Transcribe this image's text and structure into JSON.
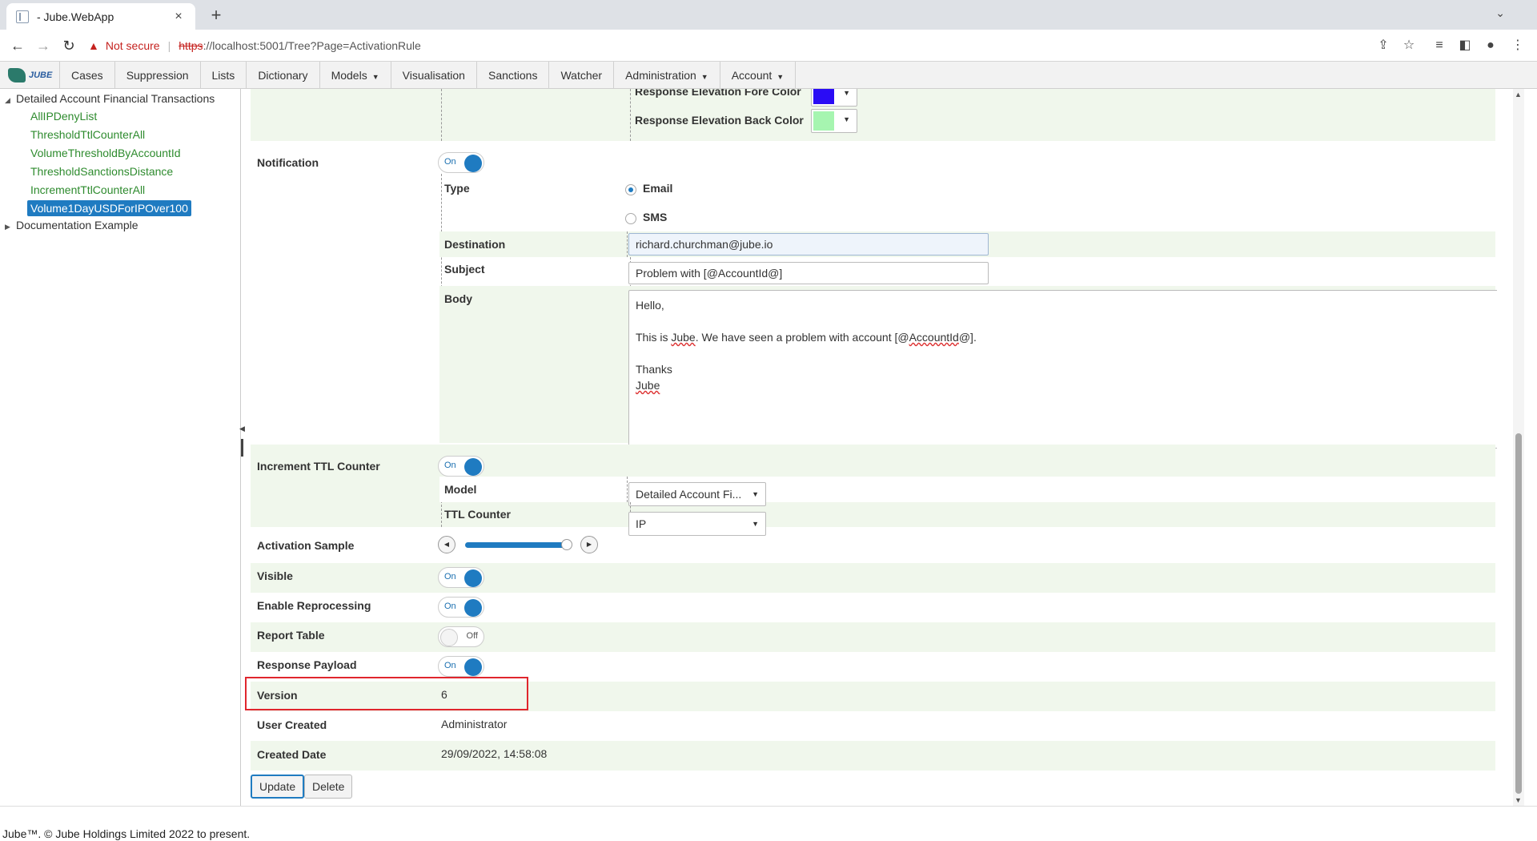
{
  "browser": {
    "tab_title": "- Jube.WebApp",
    "tab_close": "×",
    "new_tab": "+",
    "security_label": "Not secure",
    "url_scheme": "https",
    "url_rest": "://localhost:5001/Tree?Page=ActivationRule"
  },
  "menu": {
    "logo_text": "JUBE",
    "items": [
      {
        "label": "Cases"
      },
      {
        "label": "Suppression"
      },
      {
        "label": "Lists"
      },
      {
        "label": "Dictionary"
      },
      {
        "label": "Models",
        "has_caret": true
      },
      {
        "label": "Visualisation"
      },
      {
        "label": "Sanctions"
      },
      {
        "label": "Watcher"
      },
      {
        "label": "Administration",
        "has_caret": true
      },
      {
        "label": "Account",
        "has_caret": true
      }
    ]
  },
  "tree": {
    "root1": "Detailed Account Financial Transactions",
    "leaves": [
      "AllIPDenyList",
      "ThresholdTtlCounterAll",
      "VolumeThresholdByAccountId",
      "ThresholdSanctionsDistance",
      "IncrementTtlCounterAll",
      "Volume1DayUSDForIPOver100"
    ],
    "selected_index": 5,
    "root2": "Documentation Example"
  },
  "form": {
    "response_elevation_fore_color_label": "Response Elevation Fore Color",
    "response_elevation_fore_color": "#2a0cf5",
    "response_elevation_back_color_label": "Response Elevation Back Color",
    "response_elevation_back_color": "#a6f5b0",
    "notification": {
      "label": "Notification",
      "toggle": "On",
      "type_label": "Type",
      "type_options": [
        "Email",
        "SMS"
      ],
      "type_selected": "Email",
      "destination_label": "Destination",
      "destination_value": "richard.churchman@jube.io",
      "subject_label": "Subject",
      "subject_value": "Problem with [@AccountId@]",
      "body_label": "Body",
      "body_line1": "Hello,",
      "body_line3_pre": "This is ",
      "body_line3_spell1": "Jube",
      "body_line3_mid": ".  We have seen a problem with account [@",
      "body_line3_spell2": "AccountId",
      "body_line3_post": "@].",
      "body_line5": "Thanks",
      "body_line6": "Jube"
    },
    "increment_ttl_counter": {
      "label": "Increment TTL Counter",
      "toggle": "On",
      "model_label": "Model",
      "model_value": "Detailed Account Fi...",
      "ttl_counter_label": "TTL Counter",
      "ttl_counter_value": "IP"
    },
    "activation_sample": {
      "label": "Activation Sample",
      "left_arrow": "◀",
      "right_arrow": "▶",
      "level_fraction": 0.98
    },
    "visible": {
      "label": "Visible",
      "toggle": "On"
    },
    "enable_reprocessing": {
      "label": "Enable Reprocessing",
      "toggle": "On"
    },
    "report_table": {
      "label": "Report Table",
      "toggle": "Off"
    },
    "response_payload": {
      "label": "Response Payload",
      "toggle": "On"
    },
    "version": {
      "label": "Version",
      "value": "6"
    },
    "user_created": {
      "label": "User Created",
      "value": "Administrator"
    },
    "created_date": {
      "label": "Created Date",
      "value": "29/09/2022, 14:58:08"
    },
    "update_label": "Update",
    "delete_label": "Delete"
  },
  "footer": {
    "text": "Jube™. © Jube Holdings Limited 2022 to present."
  },
  "colors": {
    "accent": "#1f7bc1",
    "tree_leaf": "#2e8b2e",
    "highlight": "#e0262d"
  }
}
